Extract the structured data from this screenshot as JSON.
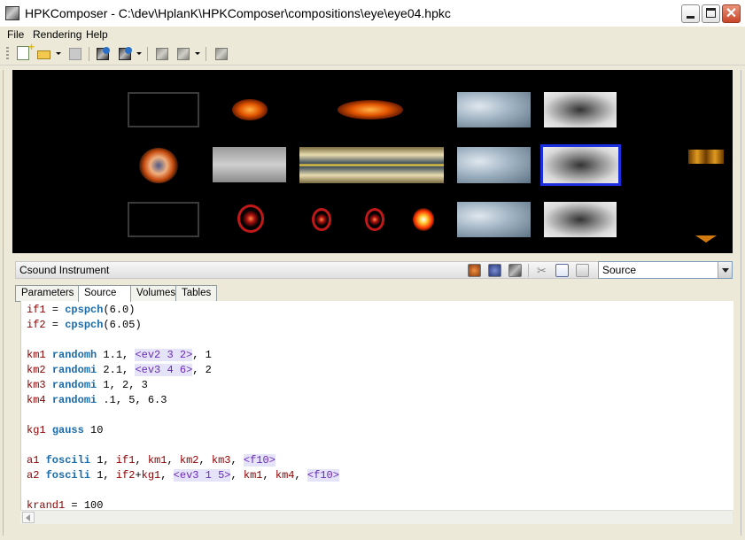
{
  "window": {
    "title": "HPKComposer - C:\\dev\\HplanK\\HPKComposer\\compositions\\eye\\eye04.hpkc",
    "close_glyph": "✕"
  },
  "menu": {
    "items": [
      "File",
      "Rendering",
      "Help"
    ]
  },
  "panel": {
    "title": "Csound Instrument",
    "combo_value": "Source"
  },
  "tabs": [
    "Parameters",
    "Source",
    "Volumes",
    "Tables"
  ],
  "active_tab": "Source",
  "code": [
    [
      {
        "t": "if1",
        "c": "v"
      },
      {
        "t": " = "
      },
      {
        "t": "cpspch",
        "c": "k"
      },
      {
        "t": "(6.0)"
      }
    ],
    [
      {
        "t": "if2",
        "c": "v"
      },
      {
        "t": " = "
      },
      {
        "t": "cpspch",
        "c": "k"
      },
      {
        "t": "(6.05)"
      }
    ],
    [],
    [
      {
        "t": "km1",
        "c": "v"
      },
      {
        "t": " "
      },
      {
        "t": "randomh",
        "c": "k"
      },
      {
        "t": " 1.1, "
      },
      {
        "t": "<ev2 3 2>",
        "c": "t"
      },
      {
        "t": ", 1"
      }
    ],
    [
      {
        "t": "km2",
        "c": "v"
      },
      {
        "t": " "
      },
      {
        "t": "randomi",
        "c": "k"
      },
      {
        "t": " 2.1, "
      },
      {
        "t": "<ev3 4 6>",
        "c": "t"
      },
      {
        "t": ", 2"
      }
    ],
    [
      {
        "t": "km3",
        "c": "v"
      },
      {
        "t": " "
      },
      {
        "t": "randomi",
        "c": "k"
      },
      {
        "t": " 1, 2, 3"
      }
    ],
    [
      {
        "t": "km4",
        "c": "v"
      },
      {
        "t": " "
      },
      {
        "t": "randomi",
        "c": "k"
      },
      {
        "t": " .1, 5, 6.3"
      }
    ],
    [],
    [
      {
        "t": "kg1",
        "c": "v"
      },
      {
        "t": " "
      },
      {
        "t": "gauss",
        "c": "k"
      },
      {
        "t": " 10"
      }
    ],
    [],
    [
      {
        "t": "a1",
        "c": "v"
      },
      {
        "t": " "
      },
      {
        "t": "foscili",
        "c": "k"
      },
      {
        "t": " 1, "
      },
      {
        "t": "if1",
        "c": "v"
      },
      {
        "t": ", "
      },
      {
        "t": "km1",
        "c": "v"
      },
      {
        "t": ", "
      },
      {
        "t": "km2",
        "c": "v"
      },
      {
        "t": ", "
      },
      {
        "t": "km3",
        "c": "v"
      },
      {
        "t": ", "
      },
      {
        "t": "<f10>",
        "c": "t"
      }
    ],
    [
      {
        "t": "a2",
        "c": "v"
      },
      {
        "t": " "
      },
      {
        "t": "foscili",
        "c": "k"
      },
      {
        "t": " 1, "
      },
      {
        "t": "if2",
        "c": "v"
      },
      {
        "t": "+"
      },
      {
        "t": "kg1",
        "c": "v"
      },
      {
        "t": ", "
      },
      {
        "t": "<ev3 1 5>",
        "c": "t"
      },
      {
        "t": ", "
      },
      {
        "t": "km1",
        "c": "v"
      },
      {
        "t": ", "
      },
      {
        "t": "km4",
        "c": "v"
      },
      {
        "t": ", "
      },
      {
        "t": "<f10>",
        "c": "t"
      }
    ],
    [],
    [
      {
        "t": "krand1",
        "c": "v"
      },
      {
        "t": " = 100"
      }
    ]
  ]
}
